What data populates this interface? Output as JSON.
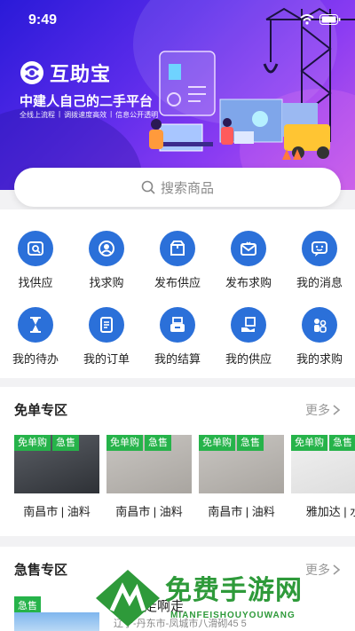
{
  "status_bar": {
    "time": "9:49"
  },
  "banner": {
    "brand_name": "互助宝",
    "slogan": "中建人自己的二手平台",
    "taglines": [
      "全线上流程",
      "调拨速度高效",
      "信息公开透明"
    ]
  },
  "search": {
    "placeholder": "搜索商品"
  },
  "menu": [
    {
      "label": "找供应",
      "icon": "find-supply-icon"
    },
    {
      "label": "找求购",
      "icon": "find-demand-icon"
    },
    {
      "label": "发布供应",
      "icon": "publish-supply-icon"
    },
    {
      "label": "发布求购",
      "icon": "publish-demand-icon"
    },
    {
      "label": "我的消息",
      "icon": "messages-icon"
    },
    {
      "label": "我的待办",
      "icon": "hourglass-icon"
    },
    {
      "label": "我的订单",
      "icon": "order-list-icon"
    },
    {
      "label": "我的结算",
      "icon": "cash-register-icon"
    },
    {
      "label": "我的供应",
      "icon": "my-supply-icon"
    },
    {
      "label": "我的求购",
      "icon": "my-demand-icon"
    }
  ],
  "free_section": {
    "title": "免单专区",
    "more": "更多",
    "cards": [
      {
        "badges": [
          "免单购",
          "急售"
        ],
        "label": "南昌市 | 油料"
      },
      {
        "badges": [
          "免单购",
          "急售"
        ],
        "label": "南昌市 | 油料"
      },
      {
        "badges": [
          "免单购",
          "急售"
        ],
        "label": "南昌市 | 油料"
      },
      {
        "badges": [
          "免单购",
          "急售"
        ],
        "label": "雅加达 | 水"
      }
    ]
  },
  "urgent_section": {
    "title": "急售专区",
    "more": "更多",
    "badge": "急售",
    "item_title": "啊扑走啊走",
    "item_location": "辽宁-丹东市-凤城市八滑砌45 5"
  },
  "watermark": {
    "title": "免费手游网",
    "subtitle": "MIANFEISHOUYOUWANG"
  },
  "colors": {
    "brand_blue": "#2b70d9",
    "badge_green": "#26b34a",
    "banner_purple": "#5a2bea"
  }
}
